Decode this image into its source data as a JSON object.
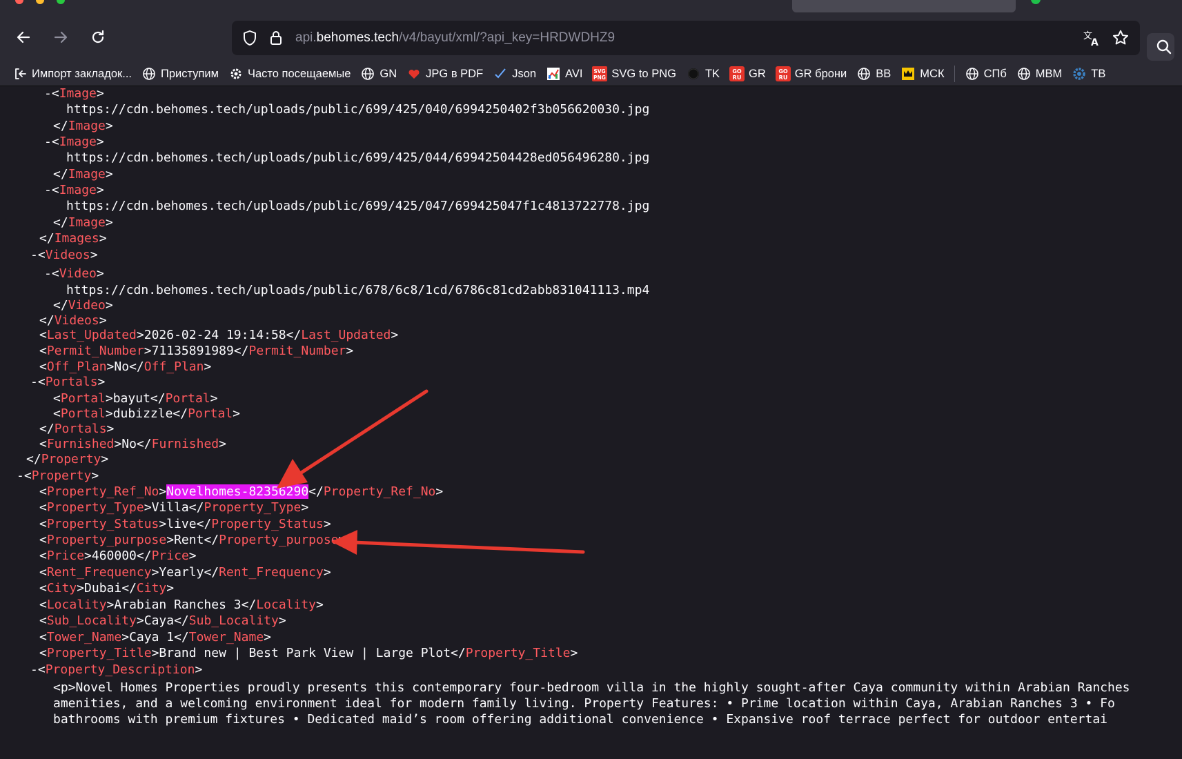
{
  "toolbar": {
    "url_host_prefix": "api.",
    "url_host": "behomes.tech",
    "url_path": "/v4/bayut/xml/?api_key=HRDWDHZ9"
  },
  "icons": {
    "back": "arrow-left-icon",
    "forward": "arrow-right-icon",
    "reload": "reload-icon",
    "shield": "shield-icon",
    "lock": "lock-icon",
    "translate": "translate-icon",
    "star": "star-icon",
    "search": "search-icon"
  },
  "bookmarks": [
    {
      "label": "Импорт закладок...",
      "icon": "import-icon"
    },
    {
      "label": "Приступим",
      "icon": "globe-icon"
    },
    {
      "label": "Часто посещаемые",
      "icon": "gear-icon"
    },
    {
      "label": "GN",
      "icon": "globe-icon"
    },
    {
      "label": "JPG в PDF",
      "icon": "heart-icon"
    },
    {
      "label": "Json",
      "icon": "check-icon"
    },
    {
      "label": "AVI",
      "icon": "chart-icon"
    },
    {
      "label": "SVG to PNG",
      "icon": "svg-png-icon",
      "badge": "SVG PNG"
    },
    {
      "label": "TK",
      "icon": "circle-icon"
    },
    {
      "label": "GR",
      "icon": "goru-icon",
      "badge": "GO RU"
    },
    {
      "label": "GR брони",
      "icon": "goru-icon",
      "badge": "GO RU"
    },
    {
      "label": "BB",
      "icon": "globe-icon"
    },
    {
      "label": "МСК",
      "icon": "crown-icon"
    },
    {
      "label": "СПб",
      "icon": "globe-icon"
    },
    {
      "label": "MBM",
      "icon": "globe-icon"
    },
    {
      "label": "TB",
      "icon": "gear-blue-icon"
    }
  ],
  "xml_lines": [
    {
      "ind": 0,
      "p": "  -<",
      "t": "Image",
      "s": ">"
    },
    {
      "ind": 0,
      "p": "     https://cdn.behomes.tech/uploads/public/699/425/040/6994250402f3b056620030.jpg"
    },
    {
      "ind": 0,
      "p": "    </",
      "t": "Image",
      "s": ">"
    },
    {
      "ind": 0,
      "p": "  -<",
      "t": "Image",
      "s": ">"
    },
    {
      "ind": 0,
      "p": "     https://cdn.behomes.tech/uploads/public/699/425/044/69942504428ed056496280.jpg"
    },
    {
      "ind": 0,
      "p": "    </",
      "t": "Image",
      "s": ">"
    },
    {
      "ind": 0,
      "p": "  -<",
      "t": "Image",
      "s": ">"
    },
    {
      "ind": 0,
      "p": "     https://cdn.behomes.tech/uploads/public/699/425/047/699425047f1c4813722778.jpg"
    },
    {
      "ind": 0,
      "p": "    </",
      "t": "Image",
      "s": ">"
    },
    {
      "ind": 0,
      "p": "   </",
      "t": "Images",
      "s": ">"
    },
    {
      "ind": 0,
      "p": " -<",
      "t": "Videos",
      "s": ">"
    }
  ],
  "xml_body": {
    "img1_url": "https://cdn.behomes.tech/uploads/public/699/425/040/6994250402f3b056620030.jpg",
    "img2_url": "https://cdn.behomes.tech/uploads/public/699/425/044/69942504428ed056496280.jpg",
    "img3_url": "https://cdn.behomes.tech/uploads/public/699/425/047/699425047f1c4813722778.jpg",
    "video_url": "https://cdn.behomes.tech/uploads/public/678/6c8/1cd/6786c81cd2abb831041113.mp4",
    "last_updated": "2026-02-24 19:14:58",
    "permit_number": "71135891989",
    "off_plan": "No",
    "portal_1": "bayut",
    "portal_2": "dubizzle",
    "furnished": "No",
    "property_ref_no": "Novelhomes-82356290",
    "property_type": "Villa",
    "property_status": "live",
    "property_purpose": "Rent",
    "price": "460000",
    "rent_frequency": "Yearly",
    "city": "Dubai",
    "locality": "Arabian Ranches 3",
    "sub_locality": "Caya",
    "tower_name": "Caya 1",
    "property_title": "Brand new | Best Park View | Large Plot",
    "desc_line_1": "<p>Novel Homes Properties proudly presents this contemporary four-bedroom villa in the highly sought-after Caya community within Arabian Ranches",
    "desc_line_2": "amenities, and a welcoming environment ideal for modern family living. Property Features: • Prime location within Caya, Arabian Ranches 3 • Fo",
    "desc_line_3": "bathrooms with premium fixtures • Dedicated maid’s room offering additional convenience • Expansive roof terrace perfect for outdoor entertai"
  },
  "tags": {
    "image": "Image",
    "images": "Images",
    "videos": "Videos",
    "video": "Video",
    "last_updated": "Last_Updated",
    "permit_number": "Permit_Number",
    "off_plan": "Off_Plan",
    "portals": "Portals",
    "portal": "Portal",
    "furnished": "Furnished",
    "property": "Property",
    "property_ref_no": "Property_Ref_No",
    "property_type": "Property_Type",
    "property_status": "Property_Status",
    "property_purpose": "Property_purpose",
    "price": "Price",
    "rent_frequency": "Rent_Frequency",
    "city": "City",
    "locality": "Locality",
    "sub_locality": "Sub_Locality",
    "tower_name": "Tower_Name",
    "property_title": "Property_Title",
    "property_description": "Property_Description"
  },
  "colors": {
    "tag": "#ff5a5f",
    "highlight": "#e416f5",
    "arrow": "#e8392f",
    "background": "#1c1b22"
  }
}
